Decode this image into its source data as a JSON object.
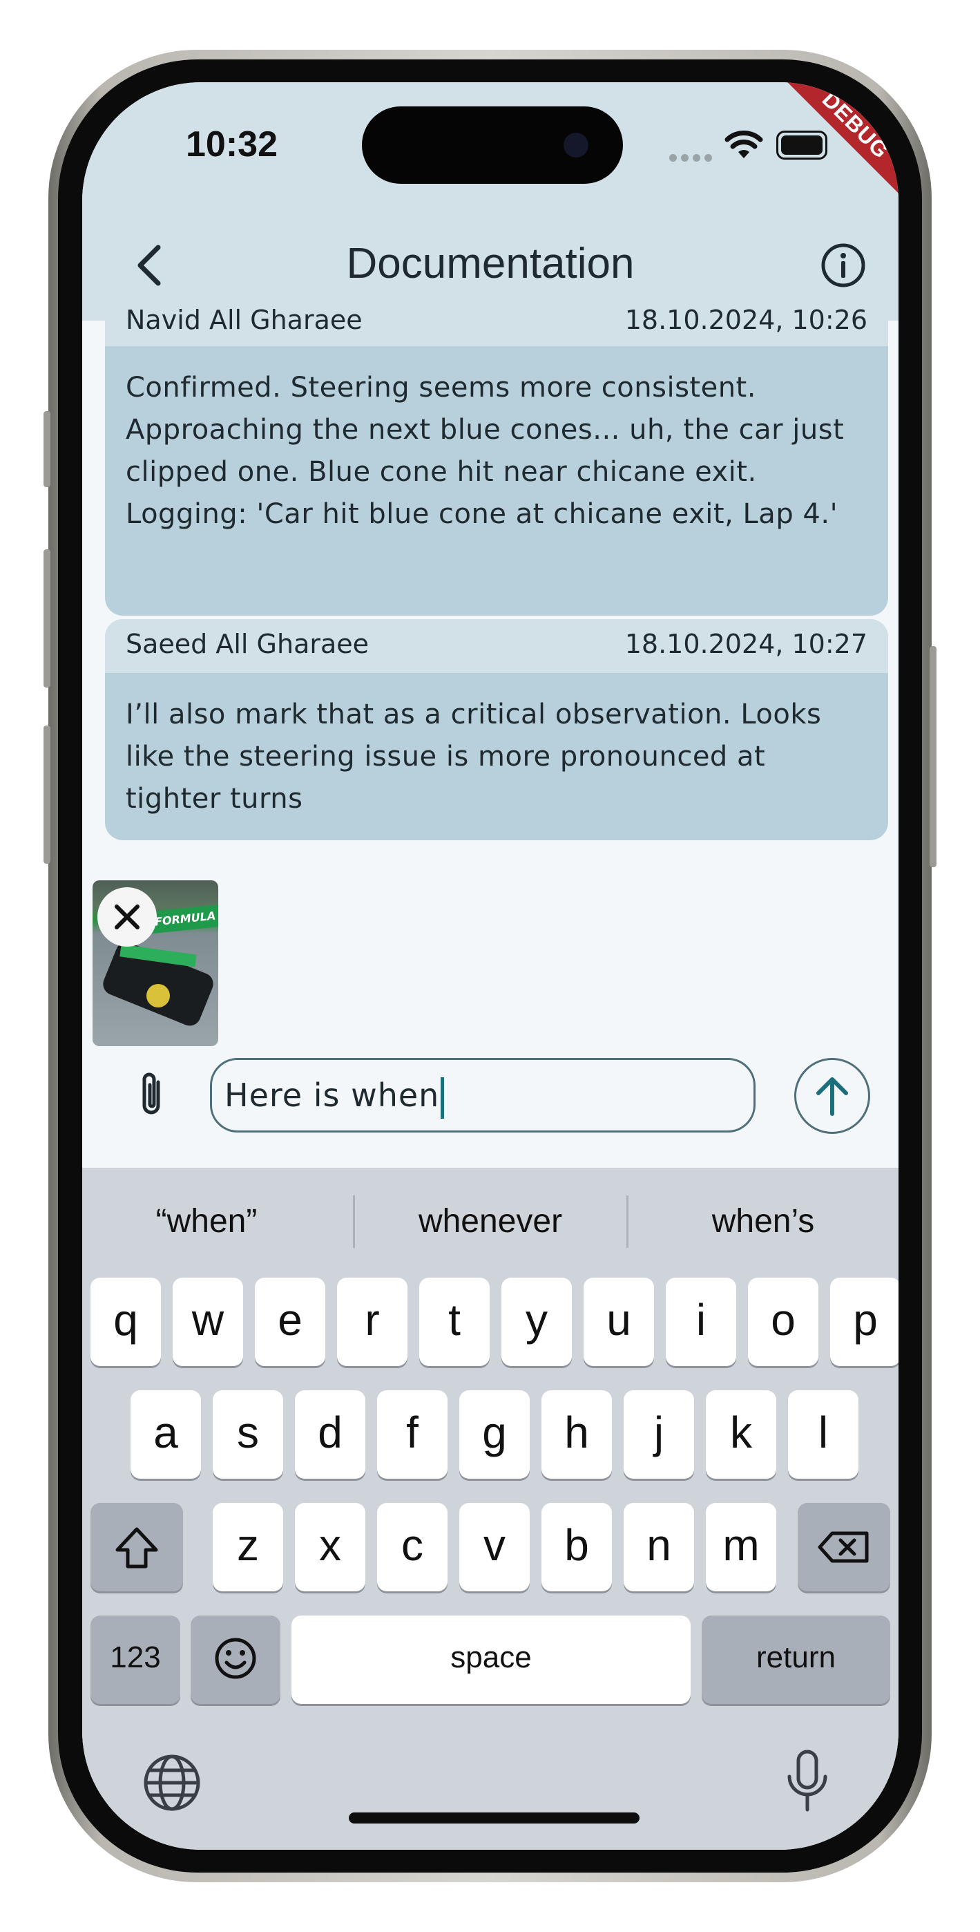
{
  "status_bar": {
    "time": "10:32",
    "debug_banner": "DEBUG"
  },
  "header": {
    "title": "Documentation",
    "back_icon": "chevron-left-icon",
    "info_icon": "info-icon"
  },
  "messages": [
    {
      "author": "Navid All Gharaee",
      "timestamp": "18.10.2024, 10:26",
      "text": "Confirmed. Steering seems more consistent. Approaching the next blue cones... uh, the car just clipped one. Blue cone hit near chicane exit. Logging: 'Car hit blue cone at chicane exit, Lap 4.'"
    },
    {
      "author": "Saeed All Gharaee",
      "timestamp": "18.10.2024, 10:27",
      "text": "I’ll also mark that as a critical observation. Looks like the steering issue is more pronounced at tighter turns"
    }
  ],
  "attachment_preview": {
    "caption": "FORMULA"
  },
  "composer": {
    "value": "Here is when"
  },
  "keyboard": {
    "suggestions": [
      "“when”",
      "whenever",
      "when’s"
    ],
    "row1": [
      "q",
      "w",
      "e",
      "r",
      "t",
      "y",
      "u",
      "i",
      "o",
      "p"
    ],
    "row2": [
      "a",
      "s",
      "d",
      "f",
      "g",
      "h",
      "j",
      "k",
      "l"
    ],
    "row3": [
      "z",
      "x",
      "c",
      "v",
      "b",
      "n",
      "m"
    ],
    "numbers_key": "123",
    "space_key": "space",
    "return_key": "return"
  },
  "colors": {
    "header_bg": "#d2e0e7",
    "bubble_bg": "#b8d0db",
    "accent": "#1b6f7c",
    "debug": "#b3272c"
  }
}
